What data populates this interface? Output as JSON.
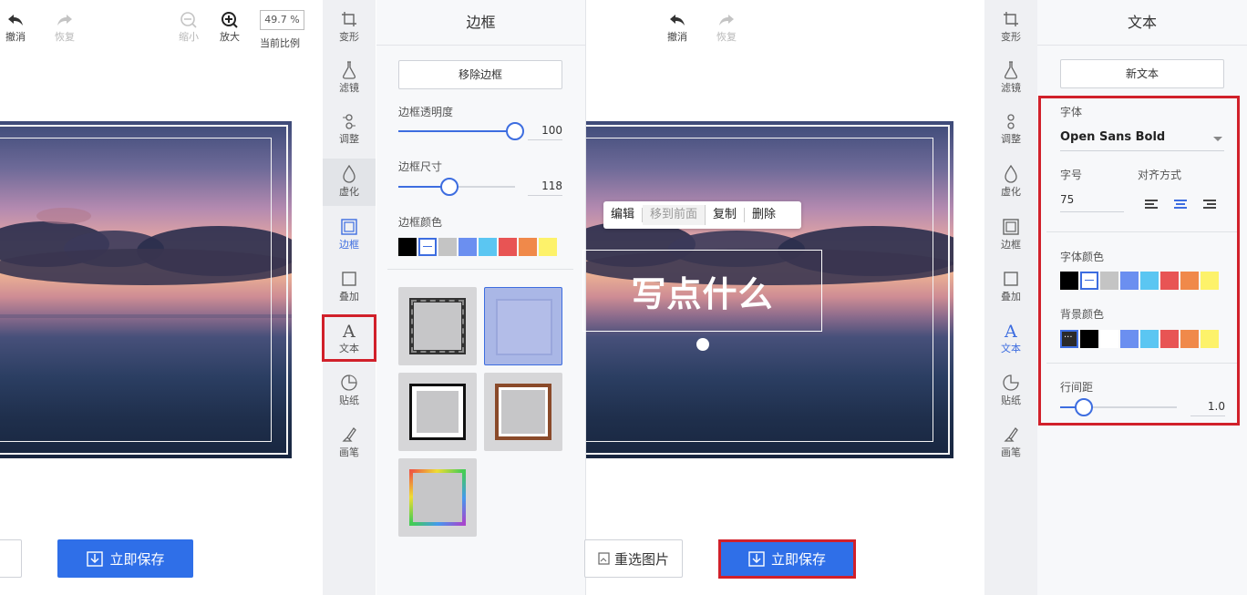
{
  "left": {
    "toolbar": {
      "undo": "撤消",
      "redo": "恢复",
      "zoom_out": "缩小",
      "zoom_in": "放大",
      "ratio_label": "当前比例",
      "ratio_value": "49.7 %"
    },
    "save_label": "立即保存",
    "panel": {
      "title": "边框",
      "remove_button": "移除边框",
      "opacity_label": "边框透明度",
      "opacity_value": "100",
      "opacity_level": 1.0,
      "size_label": "边框尺寸",
      "size_value": "118",
      "size_level": 0.44,
      "color_label": "边框颜色"
    }
  },
  "strip_items": [
    "变形",
    "滤镜",
    "调整",
    "虚化",
    "边框",
    "叠加",
    "文本",
    "贴纸",
    "画笔"
  ],
  "right": {
    "toolbar": {
      "undo": "撤消",
      "redo": "恢复"
    },
    "reselect_label": "重选图片",
    "save_label": "立即保存",
    "context_menu": [
      "编辑",
      "移到前面",
      "复制",
      "删除"
    ],
    "overlay_text": "写点什么",
    "panel": {
      "title": "文本",
      "new_text_button": "新文本",
      "font_label": "字体",
      "font_value": "Open Sans Bold",
      "size_label": "字号",
      "size_value": "75",
      "align_label": "对齐方式",
      "font_color_label": "字体颜色",
      "bg_color_label": "背景颜色",
      "line_spacing_label": "行间距",
      "line_spacing_value": "1.0",
      "line_spacing_level": 0.2
    }
  },
  "colors": {
    "accent": "#3d6de0",
    "save_button": "#2f6fe8",
    "highlight_red": "#d1202a",
    "swatches": [
      "#000000",
      "#ffffff",
      "#c4c4c4",
      "#6b8ff0",
      "#5bc6f2",
      "#e85454",
      "#f0894a",
      "#fdf26a"
    ]
  }
}
